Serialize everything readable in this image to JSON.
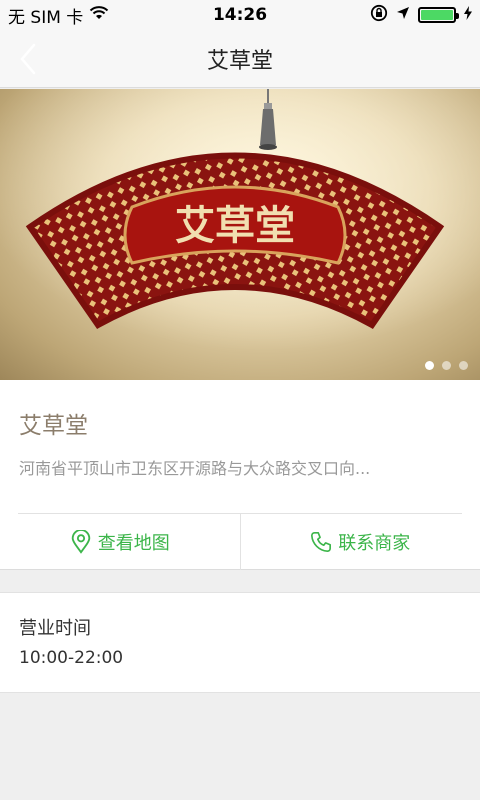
{
  "status_bar": {
    "carrier": "无 SIM 卡",
    "time": "14:26",
    "icons": [
      "wifi-icon",
      "rotation-lock-icon",
      "location-arrow-icon",
      "battery-icon",
      "charging-icon"
    ],
    "battery_level": 1.0
  },
  "nav": {
    "title": "艾草堂",
    "back_icon": "chevron-left-icon"
  },
  "banner": {
    "sign_text": "艾草堂",
    "slide_count": 3,
    "active_slide": 1
  },
  "shop": {
    "name": "艾草堂",
    "address": "河南省平顶山市卫东区开源路与大众路交叉口向..."
  },
  "actions": {
    "map_label": "查看地图",
    "map_icon": "map-pin-icon",
    "call_label": "联系商家",
    "call_icon": "phone-icon"
  },
  "hours": {
    "label": "营业时间",
    "value": "10:00-22:00"
  },
  "colors": {
    "accent_green": "#3cb54a",
    "shop_name": "#8b7d6b",
    "background": "#efefef"
  }
}
